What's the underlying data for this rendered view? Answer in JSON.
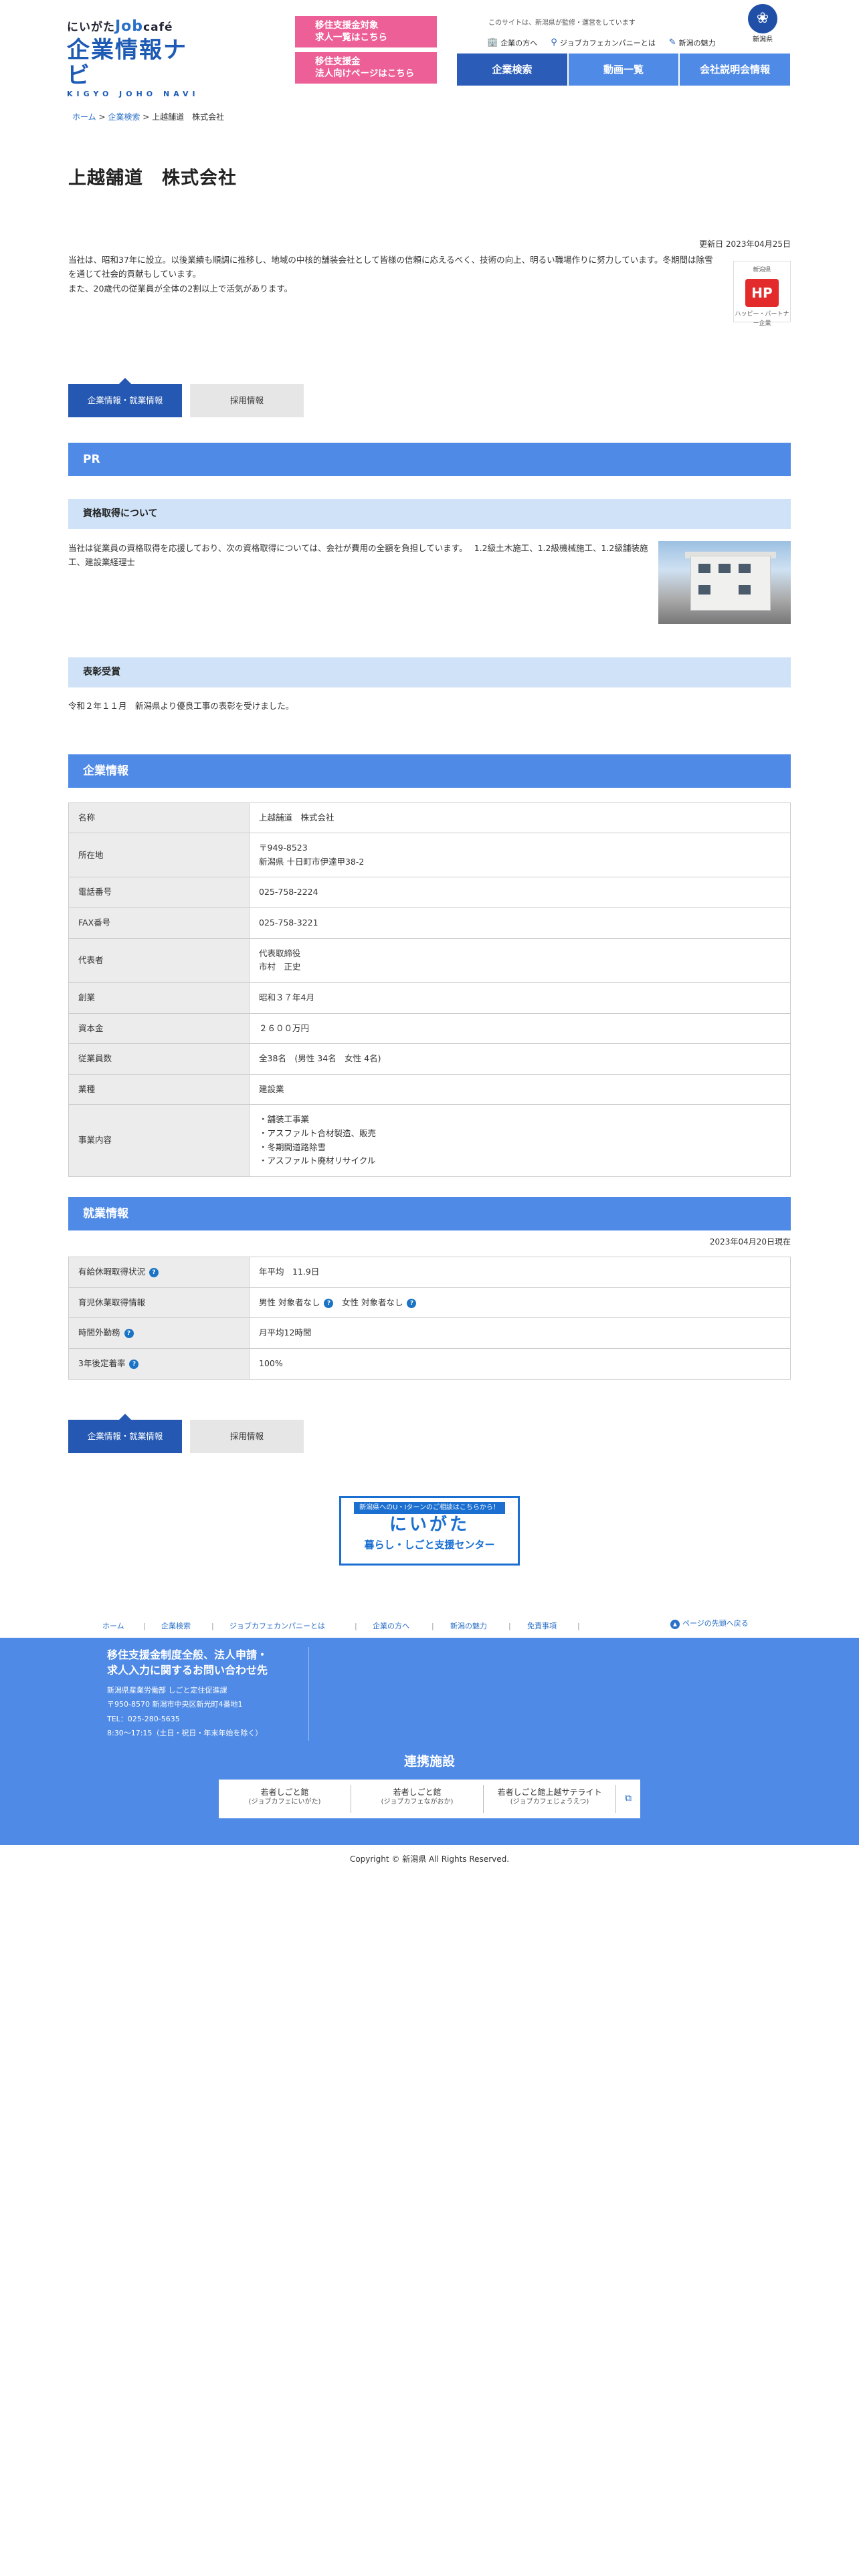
{
  "header": {
    "logo_small_pre": "にいがた",
    "logo_small_brand": "Job",
    "logo_small_post": "café",
    "logo_big": "企業情報ナビ",
    "logo_roman": "KIGYO JOHO NAVI",
    "pink_button_1_line1": "移住支援金対象",
    "pink_button_1_line2": "求人一覧はこちら",
    "pink_button_2_line1": "移住支援金",
    "pink_button_2_line2": "法人向けページはこちら",
    "tagline": "このサイトは、新潟県が監修・運営をしています",
    "emblem_label": "新潟県",
    "subnav": [
      {
        "icon": "building-icon",
        "glyph": "🏢",
        "label": "企業の方へ"
      },
      {
        "icon": "person-icon",
        "glyph": "⚲",
        "label": "ジョブカフェカンパニーとは"
      },
      {
        "icon": "pen-icon",
        "glyph": "✎",
        "label": "新潟の魅力"
      }
    ],
    "mainnav": [
      "企業検索",
      "動画一覧",
      "会社説明会情報"
    ]
  },
  "breadcrumb": {
    "home": "ホーム",
    "sep": ">",
    "search": "企業検索",
    "current": "上越舗道　株式会社"
  },
  "company": {
    "title": "上越舗道　株式会社",
    "updated": "更新日 2023年04月25日",
    "intro_line1": "当社は、昭和37年に設立。以後業績も順調に推移し、地域の中核的舗装会社として皆様の信頼に応えるべく、技術の向上、明るい職場作りに努力しています。冬期間は除雪を通じて社会的貢献もしています。",
    "intro_line2": "また、20歳代の従業員が全体の2割以上で活気があります。",
    "badge_top": "新潟県",
    "badge_mark": "HP",
    "badge_bottom": "ハッピー・パートナー企業"
  },
  "tabs": {
    "info": "企業情報・就業情報",
    "recruit": "採用情報"
  },
  "pr": {
    "head": "PR",
    "qualification_head": "資格取得について",
    "qualification_text": "当社は従業員の資格取得を応援しており、次の資格取得については、会社が費用の全額を負担しています。　 1.2級土木施工、1.2級機械施工、1.2級舗装施工、建設業経理士",
    "award_head": "表彰受賞",
    "award_text": "令和２年１１月　新潟県より優良工事の表彰を受けました。"
  },
  "info": {
    "head": "企業情報",
    "rows": [
      {
        "label": "名称",
        "lines": [
          "上越舗道　株式会社"
        ]
      },
      {
        "label": "所在地",
        "lines": [
          "〒949-8523",
          "新潟県 十日町市伊達甲38-2"
        ]
      },
      {
        "label": "電話番号",
        "lines": [
          "025-758-2224"
        ]
      },
      {
        "label": "FAX番号",
        "lines": [
          "025-758-3221"
        ]
      },
      {
        "label": "代表者",
        "lines": [
          "代表取締役",
          "市村　正史"
        ]
      },
      {
        "label": "創業",
        "lines": [
          "昭和３７年4月"
        ]
      },
      {
        "label": "資本金",
        "lines": [
          "２６００万円"
        ]
      },
      {
        "label": "従業員数",
        "lines": [
          "全38名　(男性 34名　女性 4名)"
        ]
      },
      {
        "label": "業種",
        "lines": [
          "建設業"
        ]
      },
      {
        "label": "事業内容",
        "lines": [
          "・舗装工事業",
          "・アスファルト合材製造、販売",
          "・冬期間道路除雪",
          "・アスファルト廃材リサイクル"
        ]
      }
    ]
  },
  "work": {
    "head": "就業情報",
    "as_of": "2023年04月20日現在",
    "help_glyph": "?",
    "paid_leave_label": "有給休暇取得状況",
    "paid_leave_value": "年平均　11.9日",
    "childcare_label": "育児休業取得情報",
    "childcare_male": "男性 対象者なし",
    "childcare_female": "女性 対象者なし",
    "overtime_label": "時間外勤務",
    "overtime_value": "月平均12時間",
    "retention_label": "3年後定着率",
    "retention_value": "100%"
  },
  "banner": {
    "top": "新潟県へのU・Iターンのご相談はこちらから！",
    "mid": "にいがた",
    "bottom": "暮らし・しごと支援センター"
  },
  "footer": {
    "links": [
      "ホーム",
      "企業検索",
      "ジョブカフェカンパニーとは",
      "企業の方へ",
      "新潟の魅力",
      "免責事項"
    ],
    "sep": "|",
    "pagetop": "ページの先頭へ戻る",
    "pagetop_glyph": "▲",
    "contact_title_1": "移住支援金制度全般、法人申請・",
    "contact_title_2": "求人入力に関するお問い合わせ先",
    "contact_org": "新潟県産業労働部 しごと定住促進課",
    "contact_addr": "〒950-8570 新潟市中央区新光町4番地1",
    "contact_tel": "TEL：025-280-5635",
    "contact_hours": "8:30～17:15（土日・祝日・年末年始を除く）",
    "partner_title": "連携施設",
    "partners": [
      {
        "name": "若者しごと館",
        "sub": "(ジョブカフェにいがた)"
      },
      {
        "name": "若者しごと館",
        "sub": "(ジョブカフェながおか)"
      },
      {
        "name": "若者しごと館上越サテライト",
        "sub": "(ジョブカフェじょうえつ)"
      }
    ],
    "external_glyph": "⧉",
    "copyright": "Copyright © 新潟県 All Rights Reserved."
  }
}
